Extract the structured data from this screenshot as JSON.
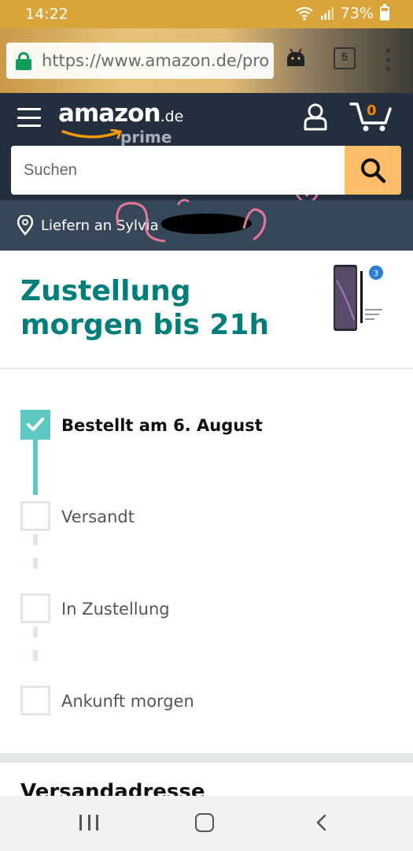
{
  "status_bar": {
    "time": "14:22",
    "battery": "73%",
    "icons": [
      "wifi-icon",
      "signal-icon",
      "battery-icon"
    ]
  },
  "browser": {
    "url": "https://www.amazon.de/pro",
    "tab_count": "5",
    "icons": [
      "lock-icon",
      "android-icon",
      "tabs-icon",
      "menu-dots-icon"
    ]
  },
  "header": {
    "logo_word": "amazon",
    "logo_tld": ".de",
    "logo_prime": "prime",
    "cart_count": "0",
    "search_placeholder": "Suchen",
    "deliver_to": "Liefern an Sylvia -",
    "accent_color": "#febd69",
    "header_color": "#232f3e"
  },
  "shipment": {
    "headline": "Zustellung morgen bis 21h",
    "headline_color": "#007f7a",
    "product_badge": "3"
  },
  "tracker": {
    "steps": [
      {
        "label": "Bestellt am 6. August",
        "done": true
      },
      {
        "label": "Versandt",
        "done": false
      },
      {
        "label": "In Zustellung",
        "done": false
      },
      {
        "label": "Ankunft morgen",
        "done": false
      }
    ],
    "progress_color": "#5ec9c2"
  },
  "next_section": {
    "title": "Versandadresse"
  },
  "nav_bar": {
    "icons": [
      "recents-icon",
      "home-icon",
      "back-icon"
    ]
  }
}
